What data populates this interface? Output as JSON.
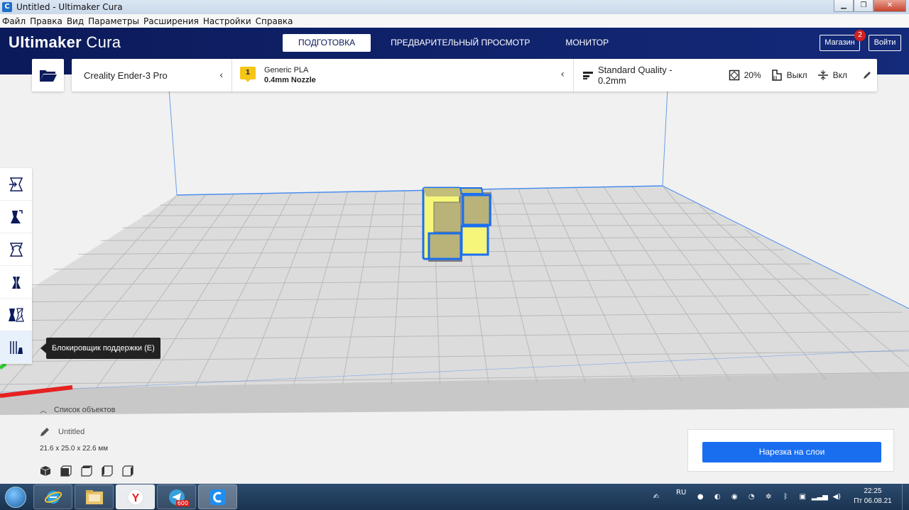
{
  "window": {
    "title": "Untitled - Ultimaker Cura",
    "app_icon": "C"
  },
  "menu": [
    "Файл",
    "Правка",
    "Вид",
    "Параметры",
    "Расширения",
    "Настройки",
    "Справка"
  ],
  "header": {
    "logo_bold": "Ultimaker",
    "logo_light": " Cura",
    "stages": [
      "ПОДГОТОВКА",
      "ПРЕДВАРИТЕЛЬНЫЙ ПРОСМОТР",
      "МОНИТОР"
    ],
    "active_stage": "ПОДГОТОВКА",
    "marketplace": "Магазин",
    "marketplace_badge": "2",
    "signin": "Войти"
  },
  "config": {
    "printer": "Creality Ender-3 Pro",
    "extruder_number": "1",
    "material": "Generic PLA",
    "nozzle": "0.4mm Nozzle",
    "quality": "Standard Quality - 0.2mm",
    "infill": "20%",
    "support": "Выкл",
    "adhesion": "Вкл"
  },
  "tooltip": "Блокировщик поддержки (E)",
  "object_list": {
    "header": "Список объектов",
    "name": "Untitled",
    "dimensions": "21.6 x 25.0 x 22.6 мм"
  },
  "slice": {
    "button": "Нарезка на слои"
  },
  "taskbar": {
    "language": "RU",
    "time": "22:25",
    "date": "Пт 06.08.21",
    "telegram_badge": "600"
  },
  "colors": {
    "header_bg": "#0b1a5a",
    "accent": "#196ef0",
    "extruder": "#f5c518",
    "model_face": "#b9b37a",
    "model_selected": "#f6f67a",
    "model_outline": "#1a6ff0"
  }
}
